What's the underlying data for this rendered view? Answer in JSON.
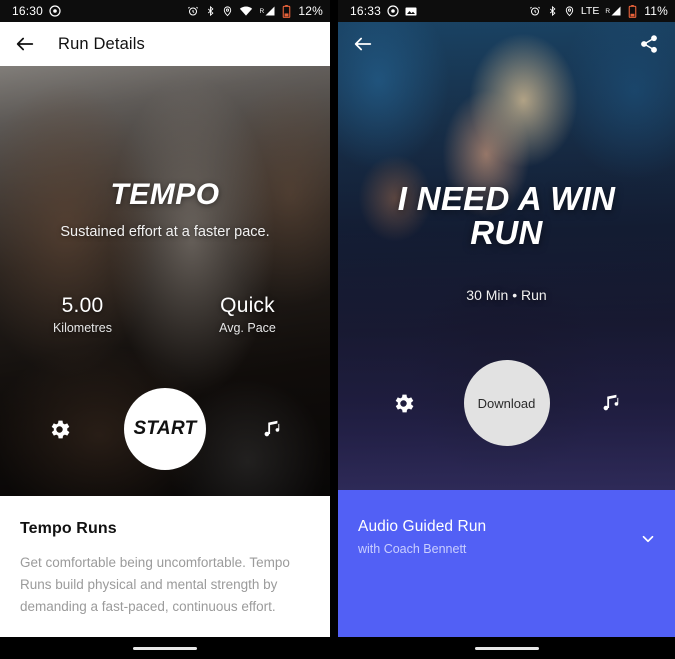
{
  "colors": {
    "accent_purple": "#5260f5",
    "status_bar_bg": "#0d0d0d",
    "start_button_bg": "#ffffff",
    "download_button_bg": "#e2e2e2",
    "body_text_gray": "#9b9b9b"
  },
  "left_phone": {
    "status_bar": {
      "time": "16:30",
      "left_icons": [
        "record-icon"
      ],
      "right_icons": [
        "alarm-icon",
        "bluetooth-icon",
        "location-icon",
        "wifi-icon",
        "signal-icon",
        "battery-icon"
      ],
      "signal_sup": "R",
      "battery_percent": "12%"
    },
    "app_bar": {
      "back_icon": "back-arrow-icon",
      "title": "Run Details"
    },
    "hero": {
      "title": "TEMPO",
      "subtitle": "Sustained effort at a faster pace.",
      "stats": [
        {
          "value": "5.00",
          "label": "Kilometres"
        },
        {
          "value": "Quick",
          "label": "Avg. Pace"
        }
      ],
      "settings_icon": "gear-icon",
      "start_label": "START",
      "music_icon": "music-note-icon"
    },
    "description": {
      "heading": "Tempo Runs",
      "body": "Get comfortable being uncomfortable. Tempo Runs build physical and mental strength by demanding a fast-paced, continuous effort."
    }
  },
  "right_phone": {
    "status_bar": {
      "time": "16:33",
      "left_icons": [
        "record-icon",
        "image-icon"
      ],
      "right_icons": [
        "alarm-icon",
        "bluetooth-icon",
        "location-icon",
        "lte-icon",
        "signal-icon",
        "battery-icon"
      ],
      "network_type": "LTE",
      "signal_sup": "R",
      "battery_percent": "11%"
    },
    "top_bar": {
      "back_icon": "back-arrow-icon",
      "share_icon": "share-icon"
    },
    "hero": {
      "title_line1": "I NEED A WIN",
      "title_line2": "RUN",
      "subtitle": "30 Min • Run",
      "settings_icon": "gear-icon",
      "download_label": "Download",
      "music_icon": "music-note-icon"
    },
    "audio_card": {
      "title": "Audio Guided Run",
      "subtitle": "with Coach Bennett",
      "expand_icon": "chevron-down-icon"
    }
  }
}
